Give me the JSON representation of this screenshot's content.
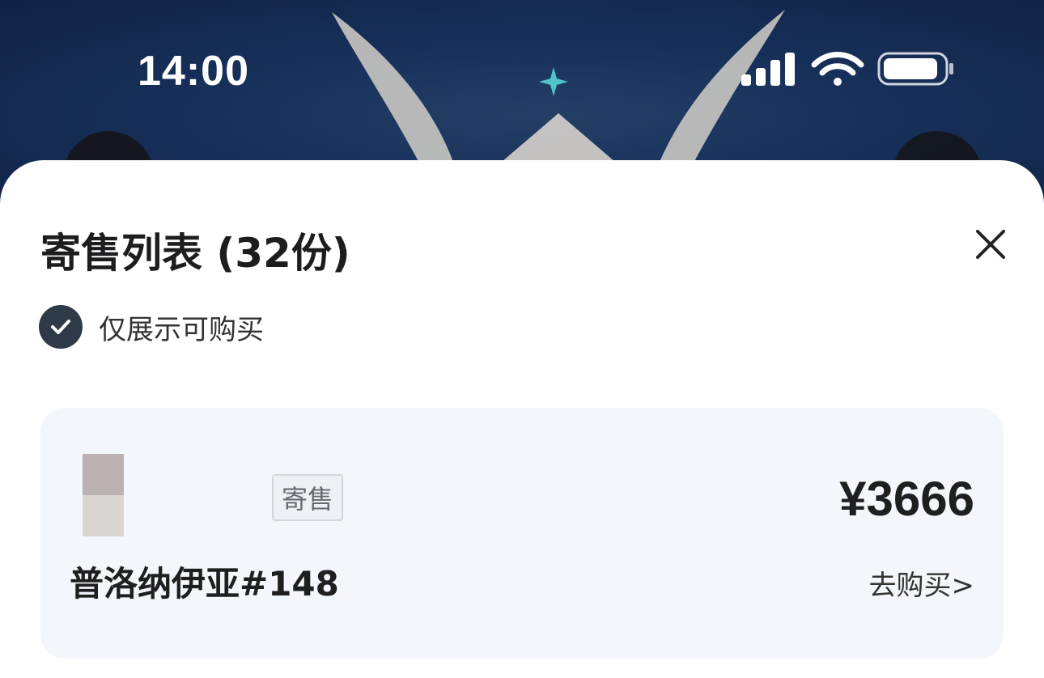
{
  "status_bar": {
    "time": "14:00",
    "icons": [
      "signal-bars-icon",
      "wifi-icon",
      "battery-icon"
    ]
  },
  "sheet": {
    "title": "寄售列表 (32份)",
    "close_icon": "close-icon",
    "filter": {
      "checked": true,
      "label": "仅展示可购买"
    },
    "listings": [
      {
        "tag": "寄售",
        "name": "普洛纳伊亚#148",
        "price": "¥3666",
        "action": "去购买>"
      }
    ]
  },
  "colors": {
    "hero_background": "#16294a",
    "sheet_background": "#ffffff",
    "card_background": "#f3f6fa",
    "check_fill": "#2f3a48"
  }
}
